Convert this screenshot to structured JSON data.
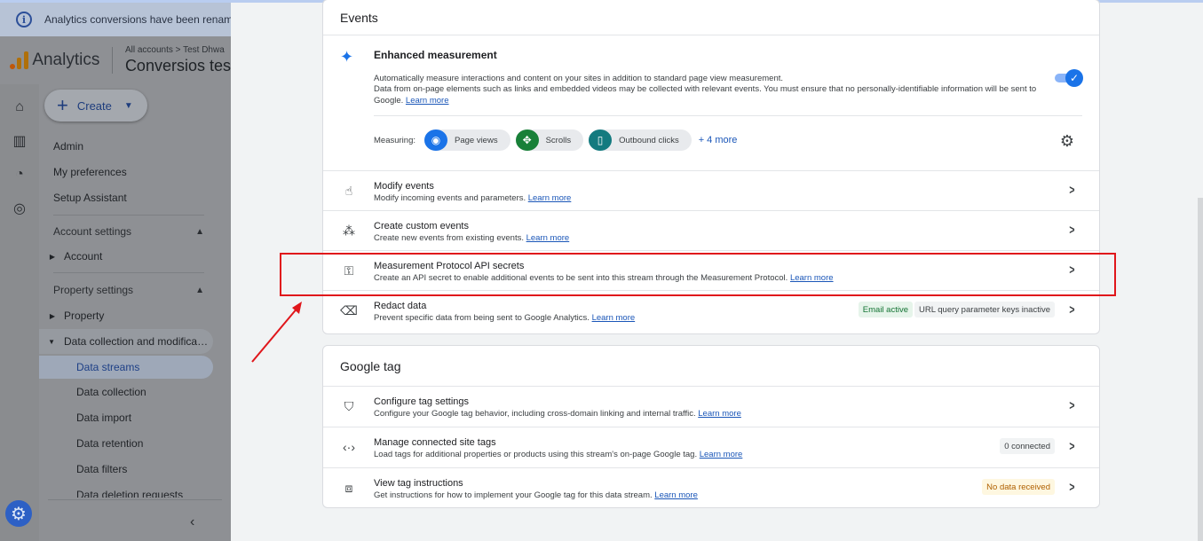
{
  "banner": {
    "text": "Analytics conversions have been renamed"
  },
  "header": {
    "app_name": "Analytics",
    "breadcrumb": "All accounts > Test Dhwa",
    "property": "Conversios tes"
  },
  "create": {
    "label": "Create"
  },
  "nav": {
    "admin": "Admin",
    "preferences": "My preferences",
    "setup": "Setup Assistant",
    "account_settings": "Account settings",
    "account": "Account",
    "property_settings": "Property settings",
    "property": "Property",
    "data_collection_mod": "Data collection and modifica…",
    "data_streams": "Data streams",
    "data_collection": "Data collection",
    "data_import": "Data import",
    "data_retention": "Data retention",
    "data_filters": "Data filters",
    "data_deletion": "Data deletion requests"
  },
  "events": {
    "title": "Events",
    "enhanced": {
      "title": "Enhanced measurement",
      "desc1": "Automatically measure interactions and content on your sites in addition to standard page view measurement.",
      "desc2": "Data from on-page elements such as links and embedded videos may be collected with relevant events. You must ensure that no personally-identifiable information will be sent to Google.",
      "learn_more": "Learn more",
      "measuring_label": "Measuring:",
      "chips": [
        "Page views",
        "Scrolls",
        "Outbound clicks"
      ],
      "more": "+ 4 more",
      "enabled": true
    },
    "rows": [
      {
        "title": "Modify events",
        "sub": "Modify incoming events and parameters.",
        "link": "Learn more"
      },
      {
        "title": "Create custom events",
        "sub": "Create new events from existing events.",
        "link": "Learn more"
      },
      {
        "title": "Measurement Protocol API secrets",
        "sub": "Create an API secret to enable additional events to be sent into this stream through the Measurement Protocol.",
        "link": "Learn more"
      },
      {
        "title": "Redact data",
        "sub": "Prevent specific data from being sent to Google Analytics.",
        "link": "Learn more",
        "badge1": "Email active",
        "badge2": "URL query parameter keys inactive"
      }
    ]
  },
  "google_tag": {
    "title": "Google tag",
    "rows": [
      {
        "title": "Configure tag settings",
        "sub": "Configure your Google tag behavior, including cross-domain linking and internal traffic.",
        "link": "Learn more"
      },
      {
        "title": "Manage connected site tags",
        "sub": "Load tags for additional properties or products using this stream's on-page Google tag.",
        "link": "Learn more",
        "badge": "0 connected"
      },
      {
        "title": "View tag instructions",
        "sub": "Get instructions for how to implement your Google tag for this data stream.",
        "link": "Learn more",
        "badge": "No data received"
      }
    ]
  },
  "colors": {
    "accent": "#1a73e8",
    "highlight": "#e0161b",
    "scrolls_chip": "#188038",
    "outbound_chip": "#137a7f"
  }
}
